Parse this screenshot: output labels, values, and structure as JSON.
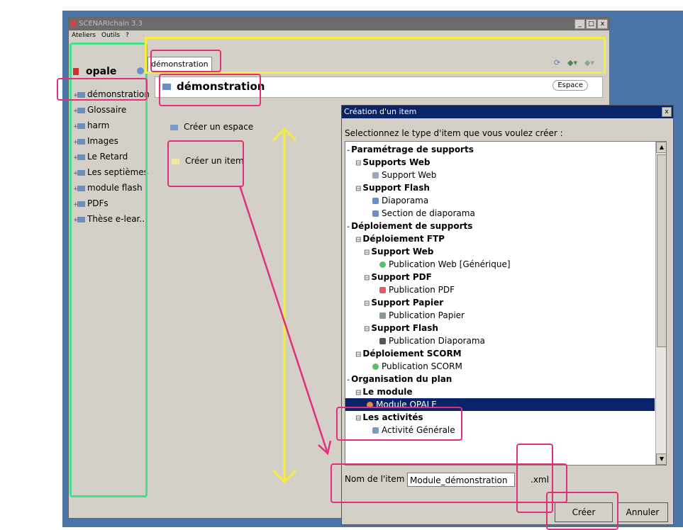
{
  "window": {
    "title": "SCENARIchain 3.3",
    "controls": [
      "_",
      "□",
      "x"
    ]
  },
  "menu": [
    "Ateliers",
    "Outils",
    "?"
  ],
  "workspace": {
    "name": "opale",
    "items": [
      "démonstration",
      "Glossaire",
      "harm",
      "Images",
      "Le Retard",
      "Les septièmes",
      "module flash",
      "PDFs",
      "Thèse e-lear..."
    ]
  },
  "tab": {
    "label": "démonstration"
  },
  "space": {
    "title": "démonstration",
    "badge": "Espace",
    "create_space": "Créer un espace",
    "create_item": "Créer un item"
  },
  "dialog": {
    "title": "Création d'un item",
    "close": "x",
    "prompt": "Selectionnez le type d'item que vous voulez créer :",
    "tree": [
      "Paramétrage de supports",
      "Supports Web",
      "Support Web",
      "Support Flash",
      "Diaporama",
      "Section de diaporama",
      "Déploiement de supports",
      "Déploiement FTP",
      "Support Web",
      "Publication Web [Générique]",
      "Support PDF",
      "Publication PDF",
      "Support Papier",
      "Publication Papier",
      "Support Flash",
      "Publication Diaporama",
      "Déploiement SCORM",
      "Publication SCORM",
      "Organisation du plan",
      "Le module",
      "Module OPALE",
      "Les activités",
      "Activité Générale"
    ],
    "name_label": "Nom de l'item :",
    "name_value": "Module_démonstration",
    "extension": ".xml",
    "create_button": "Créer",
    "cancel_button": "Annuler"
  },
  "colors": {
    "yellow_highlight": "#f6ef3a",
    "magenta_highlight": "#e0307a",
    "green_highlight": "#47e08a",
    "selection": "#0a246a"
  }
}
